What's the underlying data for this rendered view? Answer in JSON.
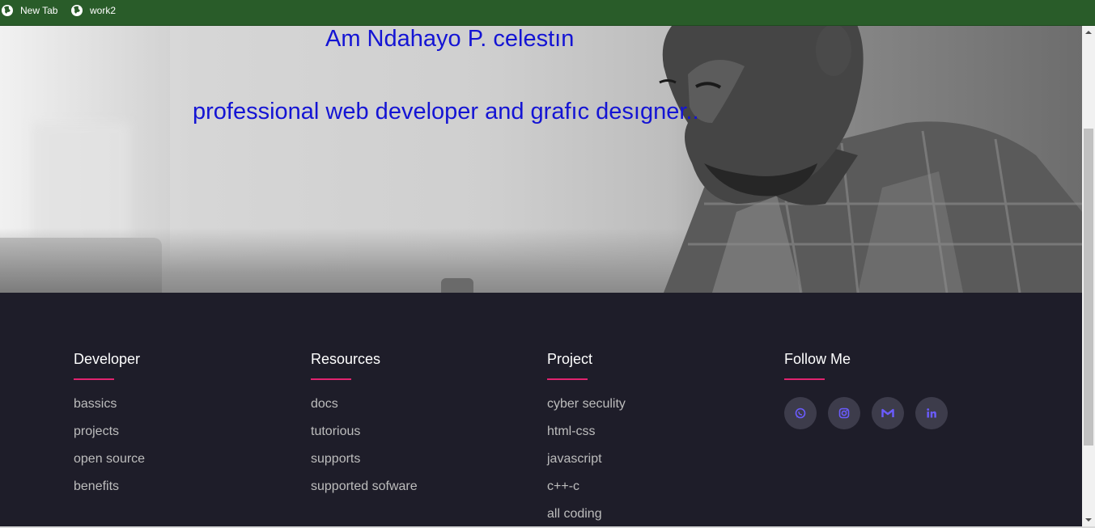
{
  "bookmarks": [
    {
      "label": "New Tab",
      "icon": "globe-icon"
    },
    {
      "label": "work2",
      "icon": "globe-icon"
    }
  ],
  "hero": {
    "title": "Am Ndahayo P. celestın",
    "subtitle": "professional web developer and grafıc desıgner.."
  },
  "footer": {
    "columns": [
      {
        "heading": "Developer",
        "items": [
          "bassics",
          "projects",
          "open source",
          "benefits"
        ]
      },
      {
        "heading": "Resources",
        "items": [
          "docs",
          "tutorious",
          "supports",
          "supported sofware"
        ]
      },
      {
        "heading": "Project",
        "items": [
          "cyber seculity",
          "html-css",
          "javascript",
          "c++-c",
          "all coding"
        ]
      }
    ],
    "follow": {
      "heading": "Follow Me",
      "icons": [
        "whatsapp-icon",
        "instagram-icon",
        "gmail-icon",
        "linkedin-icon"
      ]
    }
  },
  "colors": {
    "bookmark_bar": "#295c29",
    "footer_bg": "#1e1d29",
    "accent_underline": "#e0246f",
    "hero_text": "#1414d4",
    "social_icon": "#6b5cff"
  }
}
